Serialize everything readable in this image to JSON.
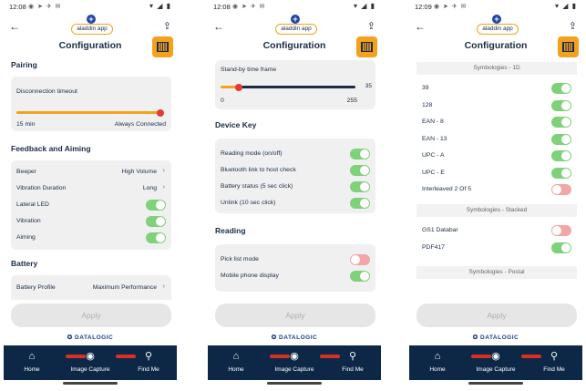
{
  "common": {
    "apps_icons": "◉ ➤ ✈ ✉",
    "sys_icons": "▾ ◢ ▮",
    "back_glyph": "←",
    "share_glyph": "⇪",
    "logo_plus": "+",
    "logo_text": "aladdin app",
    "title": "Configuration",
    "apply_label": "Apply",
    "brand": "✪ DATALOGIC",
    "nav": {
      "home_icon": "⌂",
      "home_label": "Home",
      "capture_icon": "◉",
      "capture_label": "Image Capture",
      "find_icon": "⚲",
      "find_label": "Find Me"
    },
    "chevron": "›",
    "colors": {
      "accent": "#f4a21d",
      "navy": "#0d2846",
      "toggle_on": "#7fd17a",
      "toggle_off": "#f2a6a6",
      "slider_thumb": "#e53935"
    }
  },
  "screen1": {
    "time": "12:08",
    "sections": {
      "pairing": "Pairing",
      "feedback": "Feedback and Aiming",
      "battery": "Battery"
    },
    "disconnection": {
      "label": "Disconnection timeout",
      "min_label": "15 min",
      "max_label": "Always Connected",
      "value_fraction": 1.0
    },
    "beeper": {
      "label": "Beeper",
      "value": "High Volume"
    },
    "vibration_duration": {
      "label": "Vibration Duration",
      "value": "Long"
    },
    "lateral_led": {
      "label": "Lateral LED",
      "state": "on"
    },
    "vibration": {
      "label": "Vibration",
      "state": "on"
    },
    "aiming": {
      "label": "Aiming",
      "state": "on"
    },
    "battery_profile": {
      "label": "Battery Profile",
      "value": "Maximum Performance"
    }
  },
  "screen2": {
    "time": "12:08",
    "standby": {
      "label": "Stand-by time frame",
      "min_label": "0",
      "max_label": "255",
      "value": 35
    },
    "sections": {
      "device_key": "Device Key",
      "reading": "Reading"
    },
    "reading_mode": {
      "label": "Reading mode (on/off)",
      "state": "on"
    },
    "bluetooth_link": {
      "label": "Bluetooth link to host check",
      "state": "on"
    },
    "battery_status": {
      "label": "Battery status (5 sec click)",
      "state": "on"
    },
    "unlink": {
      "label": "Unlink (10 sec click)",
      "state": "on"
    },
    "pick_list": {
      "label": "Pick list mode",
      "state": "off"
    },
    "mobile_phone": {
      "label": "Mobile phone display",
      "state": "on"
    }
  },
  "screen3": {
    "time": "12:09",
    "headers": {
      "one_d": "Symbologies - 1D",
      "stacked": "Symbologies - Stacked",
      "postal": "Symbologies - Postal"
    },
    "symbologies_1d": [
      {
        "label": "39",
        "state": "on"
      },
      {
        "label": "128",
        "state": "on"
      },
      {
        "label": "EAN - 8",
        "state": "on"
      },
      {
        "label": "EAN - 13",
        "state": "on"
      },
      {
        "label": "UPC - A",
        "state": "on"
      },
      {
        "label": "UPC - E",
        "state": "on"
      },
      {
        "label": "Interleaved 2 Of 5",
        "state": "off"
      }
    ],
    "symbologies_stacked": [
      {
        "label": "GS1 Databar",
        "state": "off"
      },
      {
        "label": "PDF417",
        "state": "on"
      }
    ]
  }
}
